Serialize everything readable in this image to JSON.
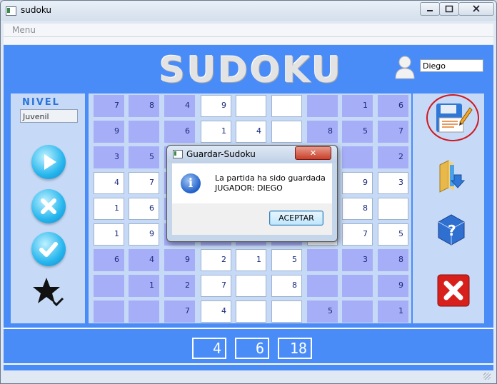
{
  "window": {
    "title": "sudoku",
    "min_label": "▭",
    "max_label": "□",
    "close_label": "✕"
  },
  "menu": {
    "items": [
      "Menu"
    ]
  },
  "header": {
    "title": "SUDOKU",
    "username": "Diego"
  },
  "left_panel": {
    "nivel_label": "NIVEL",
    "nivel_value": "Juvenil"
  },
  "grid": {
    "rows": [
      [
        {
          "v": "7",
          "g": true
        },
        {
          "v": "8",
          "g": true
        },
        {
          "v": "4",
          "g": true
        },
        {
          "v": "9",
          "g": false
        },
        {
          "v": "",
          "g": false
        },
        {
          "v": "",
          "g": false
        },
        {
          "v": "",
          "g": true
        },
        {
          "v": "1",
          "g": true
        },
        {
          "v": "6",
          "g": true
        }
      ],
      [
        {
          "v": "9",
          "g": true
        },
        {
          "v": "",
          "g": true
        },
        {
          "v": "6",
          "g": true
        },
        {
          "v": "1",
          "g": false
        },
        {
          "v": "4",
          "g": false
        },
        {
          "v": "",
          "g": false
        },
        {
          "v": "8",
          "g": true
        },
        {
          "v": "5",
          "g": true
        },
        {
          "v": "7",
          "g": true
        }
      ],
      [
        {
          "v": "3",
          "g": true
        },
        {
          "v": "5",
          "g": true
        },
        {
          "v": "",
          "g": true
        },
        {
          "v": "",
          "g": false
        },
        {
          "v": "",
          "g": false
        },
        {
          "v": "",
          "g": false
        },
        {
          "v": "",
          "g": true
        },
        {
          "v": "",
          "g": true
        },
        {
          "v": "2",
          "g": true
        }
      ],
      [
        {
          "v": "4",
          "g": false
        },
        {
          "v": "7",
          "g": false
        },
        {
          "v": "",
          "g": true
        },
        {
          "v": "",
          "g": true
        },
        {
          "v": "",
          "g": true
        },
        {
          "v": "",
          "g": true
        },
        {
          "v": "",
          "g": false
        },
        {
          "v": "9",
          "g": false
        },
        {
          "v": "3",
          "g": false
        }
      ],
      [
        {
          "v": "1",
          "g": false
        },
        {
          "v": "6",
          "g": false
        },
        {
          "v": "",
          "g": true
        },
        {
          "v": "",
          "g": true
        },
        {
          "v": "",
          "g": true
        },
        {
          "v": "",
          "g": true
        },
        {
          "v": "",
          "g": false
        },
        {
          "v": "8",
          "g": false
        },
        {
          "v": "",
          "g": false
        }
      ],
      [
        {
          "v": "1",
          "g": false
        },
        {
          "v": "9",
          "g": false
        },
        {
          "v": "",
          "g": true
        },
        {
          "v": "",
          "g": true
        },
        {
          "v": "",
          "g": true
        },
        {
          "v": "",
          "g": true
        },
        {
          "v": "",
          "g": false
        },
        {
          "v": "7",
          "g": false
        },
        {
          "v": "5",
          "g": false
        }
      ],
      [
        {
          "v": "6",
          "g": true
        },
        {
          "v": "4",
          "g": true
        },
        {
          "v": "9",
          "g": true
        },
        {
          "v": "2",
          "g": false
        },
        {
          "v": "1",
          "g": false
        },
        {
          "v": "5",
          "g": false
        },
        {
          "v": "",
          "g": true
        },
        {
          "v": "3",
          "g": true
        },
        {
          "v": "8",
          "g": true
        }
      ],
      [
        {
          "v": "",
          "g": true
        },
        {
          "v": "1",
          "g": true
        },
        {
          "v": "2",
          "g": true
        },
        {
          "v": "7",
          "g": false
        },
        {
          "v": "",
          "g": false
        },
        {
          "v": "8",
          "g": false
        },
        {
          "v": "",
          "g": true
        },
        {
          "v": "",
          "g": true
        },
        {
          "v": "9",
          "g": true
        }
      ],
      [
        {
          "v": "",
          "g": true
        },
        {
          "v": "",
          "g": true
        },
        {
          "v": "7",
          "g": true
        },
        {
          "v": "4",
          "g": false
        },
        {
          "v": "",
          "g": false
        },
        {
          "v": "",
          "g": false
        },
        {
          "v": "5",
          "g": true
        },
        {
          "v": "",
          "g": true
        },
        {
          "v": "1",
          "g": true
        }
      ]
    ]
  },
  "timer": {
    "d1": "4",
    "d2": "6",
    "d3": "18"
  },
  "dialog": {
    "title": "Guardar-Sudoku",
    "close_label": "✕",
    "info_glyph": "i",
    "line1": "La partida ha sido guardada",
    "line2": "JUGADOR: DIEGO",
    "ok_label": "ACEPTAR"
  },
  "colors": {
    "accent": "#4a8cf7",
    "panel": "#c6daf7",
    "given_cell": "#a7aef8",
    "highlight": "#d0181e"
  }
}
